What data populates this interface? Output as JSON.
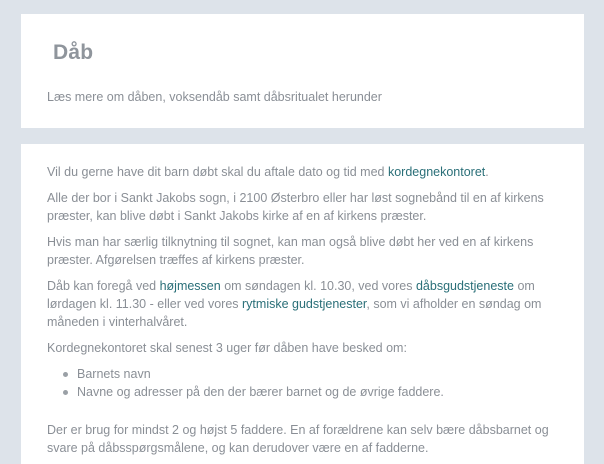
{
  "header": {
    "title": "Dåb",
    "subtitle": "Læs mere om dåben, voksendåb samt dåbsritualet herunder"
  },
  "body": {
    "p1": {
      "before": "Vil du gerne have dit barn døbt skal du aftale dato og tid med ",
      "link": "kordegnekontoret",
      "after": "."
    },
    "p2": "Alle der bor i Sankt Jakobs sogn, i 2100 Østerbro eller har løst sognebånd til en af kirkens præster, kan blive døbt i Sankt Jakobs kirke af en af kirkens præster.",
    "p3": "Hvis man har særlig tilknytning til sognet, kan man også blive døbt her ved en af kirkens præster. Afgørelsen træffes af kirkens præster.",
    "p4": {
      "t1": "Dåb kan foregå ved ",
      "link1": "højmessen",
      "t2": " om søndagen kl. 10.30, ved vores ",
      "link2": "dåbsgudstjeneste",
      "t3": " om lørdagen kl. 11.30 - eller ved vores ",
      "link3": "rytmiske gudstjenester",
      "t4": ", som vi afholder en søndag om måneden i vinterhalvåret."
    },
    "p5": "Kordegnekontoret skal senest 3 uger før dåben have besked om:",
    "list": [
      "Barnets navn",
      "Navne og adresser på den der bærer barnet og de øvrige faddere."
    ],
    "p6": "Der er brug for mindst 2 og højst 5 faddere. En af forældrene kan selv bære dåbsbarnet og svare på dåbsspørgsmålene, og kan derudover være en af fadderne."
  }
}
